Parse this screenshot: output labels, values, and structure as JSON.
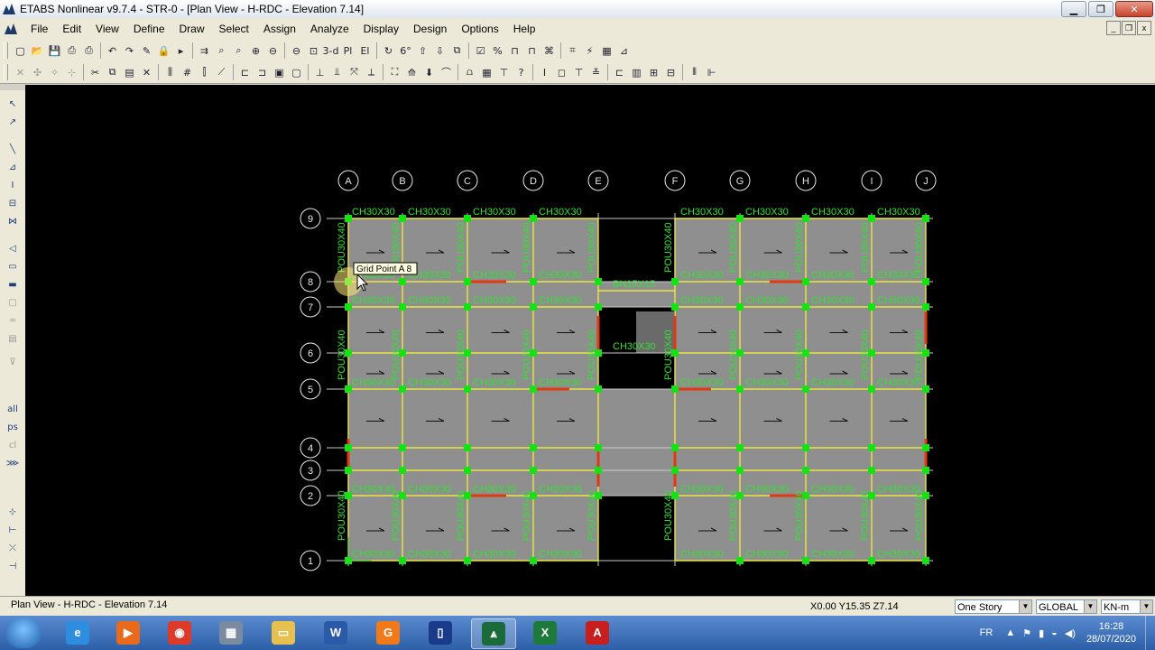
{
  "window": {
    "title": "ETABS Nonlinear v9.7.4 - STR-0 - [Plan View - H-RDC - Elevation 7.14]"
  },
  "menu": [
    "File",
    "Edit",
    "View",
    "Define",
    "Draw",
    "Select",
    "Assign",
    "Analyze",
    "Display",
    "Design",
    "Options",
    "Help"
  ],
  "toolbar1": [
    {
      "icon": "new-icon",
      "glyph": "▢"
    },
    {
      "icon": "open-icon",
      "glyph": "📂"
    },
    {
      "icon": "save-icon",
      "glyph": "💾"
    },
    {
      "icon": "print-icon",
      "glyph": "⎙"
    },
    {
      "icon": "print-preview-icon",
      "glyph": "⎙"
    },
    {
      "icon": "undo-icon",
      "glyph": "↶"
    },
    {
      "icon": "redo-icon",
      "glyph": "↷"
    },
    {
      "icon": "pencil-icon",
      "glyph": "✎"
    },
    {
      "icon": "lock-icon",
      "glyph": "🔒"
    },
    {
      "icon": "run-icon",
      "glyph": "▸"
    },
    {
      "icon": "run-steps-icon",
      "glyph": "⇉"
    },
    {
      "icon": "zoom-window-icon",
      "glyph": "⌕"
    },
    {
      "icon": "zoom-restore-icon",
      "glyph": "⌕"
    },
    {
      "icon": "zoom-in-icon",
      "glyph": "⊕"
    },
    {
      "icon": "zoom-out-icon",
      "glyph": "⊖"
    },
    {
      "icon": "zoom-all-icon",
      "glyph": "⊖"
    },
    {
      "icon": "pan-icon",
      "glyph": "⊡"
    },
    {
      "icon": "3d-view-icon",
      "glyph": "3-d"
    },
    {
      "icon": "plan-view-icon",
      "glyph": "Pl"
    },
    {
      "icon": "elevation-view-icon",
      "glyph": "El"
    },
    {
      "icon": "rotate-icon",
      "glyph": "↻"
    },
    {
      "icon": "perspective-icon",
      "glyph": "6°"
    },
    {
      "icon": "move-up-icon",
      "glyph": "⇧"
    },
    {
      "icon": "move-down-icon",
      "glyph": "⇩"
    },
    {
      "icon": "object-shrink-icon",
      "glyph": "⧉"
    },
    {
      "icon": "check-icon",
      "glyph": "☑"
    },
    {
      "icon": "assign-percent-icon",
      "glyph": "%"
    },
    {
      "icon": "frame-icon",
      "glyph": "⊓"
    },
    {
      "icon": "beam-icon",
      "glyph": "⊓"
    },
    {
      "icon": "brace-icon",
      "glyph": "⌘"
    },
    {
      "icon": "wall-icon",
      "glyph": "⌗"
    },
    {
      "icon": "lightning-icon",
      "glyph": "⚡"
    },
    {
      "icon": "grid-icon",
      "glyph": "▦"
    },
    {
      "icon": "draw-icon",
      "glyph": "⊿"
    }
  ],
  "toolbar2": [
    {
      "icon": "snap-point-icon",
      "glyph": "✕"
    },
    {
      "icon": "snap-end-icon",
      "glyph": "✣"
    },
    {
      "icon": "snap-mid-icon",
      "glyph": "✧"
    },
    {
      "icon": "snap-grid-icon",
      "glyph": "⊹"
    },
    {
      "icon": "cut-icon",
      "glyph": "✂"
    },
    {
      "icon": "copy-icon",
      "glyph": "⧉"
    },
    {
      "icon": "paste-icon",
      "glyph": "▤"
    },
    {
      "icon": "delete-icon",
      "glyph": "✕"
    },
    {
      "icon": "replicate-icon",
      "glyph": "⫼"
    },
    {
      "icon": "grid-lines-icon",
      "glyph": "#"
    },
    {
      "icon": "story-data-icon",
      "glyph": "⫿"
    },
    {
      "icon": "line-icon",
      "glyph": "⟋"
    },
    {
      "icon": "dimension-icon",
      "glyph": "⊏"
    },
    {
      "icon": "frame-section-icon",
      "glyph": "⊐"
    },
    {
      "icon": "select-all-icon",
      "glyph": "▣"
    },
    {
      "icon": "deselect-icon",
      "glyph": "▢"
    },
    {
      "icon": "join-icon",
      "glyph": "⊥"
    },
    {
      "icon": "divide-icon",
      "glyph": "⫫"
    },
    {
      "icon": "extrude-icon",
      "glyph": "⤧"
    },
    {
      "icon": "align-icon",
      "glyph": "⟂"
    },
    {
      "icon": "deformed-shape-icon",
      "glyph": "⛶"
    },
    {
      "icon": "mode-shape-icon",
      "glyph": "⟰"
    },
    {
      "icon": "loads-icon",
      "glyph": "⬇"
    },
    {
      "icon": "member-forces-icon",
      "glyph": "⌒"
    },
    {
      "icon": "stress-icon",
      "glyph": "⩍"
    },
    {
      "icon": "output-table-icon",
      "glyph": "▦"
    },
    {
      "icon": "steel-design-icon",
      "glyph": "⊤"
    },
    {
      "icon": "question-icon",
      "glyph": "?"
    },
    {
      "icon": "i-beam-icon",
      "glyph": "I"
    },
    {
      "icon": "area-section-icon",
      "glyph": "◻"
    },
    {
      "icon": "t-section-icon",
      "glyph": "⊤"
    },
    {
      "icon": "slab-icon",
      "glyph": "≚"
    },
    {
      "icon": "c-section-icon",
      "glyph": "⊏"
    },
    {
      "icon": "concrete-design-icon",
      "glyph": "▥"
    },
    {
      "icon": "shear-wall-icon",
      "glyph": "⊞"
    },
    {
      "icon": "composite-icon",
      "glyph": "⊟"
    },
    {
      "icon": "joist-icon",
      "glyph": "⫴"
    },
    {
      "icon": "wall-design-icon",
      "glyph": "⊩"
    }
  ],
  "sidebar": [
    {
      "icon": "pointer-icon",
      "glyph": "↖"
    },
    {
      "icon": "reshape-icon",
      "glyph": "↗"
    },
    {
      "icon": "draw-line-icon",
      "glyph": "╲"
    },
    {
      "icon": "draw-frame-icon",
      "glyph": "⊿"
    },
    {
      "icon": "draw-column-icon",
      "glyph": "I"
    },
    {
      "icon": "draw-beam-icon",
      "glyph": "⊟"
    },
    {
      "icon": "draw-brace-icon",
      "glyph": "⋈"
    },
    {
      "icon": "draw-area-icon",
      "glyph": "◁"
    },
    {
      "icon": "draw-rectangle-icon",
      "glyph": "▭"
    },
    {
      "icon": "draw-wall-icon",
      "glyph": "▬"
    },
    {
      "icon": "draw-opening-icon",
      "glyph": "▢"
    },
    {
      "icon": "draw-dimension-icon",
      "glyph": "═"
    },
    {
      "icon": "draw-text-icon",
      "glyph": "▤"
    },
    {
      "icon": "draw-developed-icon",
      "glyph": "⊽"
    },
    {
      "icon": "select-all-side-icon",
      "glyph": "all"
    },
    {
      "icon": "select-previous-icon",
      "glyph": "ps"
    },
    {
      "icon": "clear-selection-icon",
      "glyph": "cl"
    },
    {
      "icon": "select-intersect-icon",
      "glyph": "⋙"
    },
    {
      "icon": "snap-joint-icon",
      "glyph": "⊹"
    },
    {
      "icon": "snap-line-icon",
      "glyph": "⊢"
    },
    {
      "icon": "snap-intersect-icon",
      "glyph": "⤫"
    },
    {
      "icon": "snap-perpendicular-icon",
      "glyph": "⊣"
    }
  ],
  "plan": {
    "grid_x": [
      "A",
      "B",
      "C",
      "D",
      "E",
      "F",
      "G",
      "H",
      "I",
      "J"
    ],
    "grid_y": [
      "1",
      "2",
      "3",
      "4",
      "5",
      "6",
      "7",
      "8",
      "9"
    ],
    "beam_labels_top": [
      "CH30X30",
      "CH30X30",
      "CH30X30",
      "CH30X30",
      "CH30X30",
      "CH30X30",
      "CH30X30",
      "CH30X30"
    ],
    "beam_bridge": "BN15X15",
    "beam_mid": "CH30X30",
    "column_label": "POU30X40",
    "tooltip": "Grid Point  A  8",
    "colors": {
      "slab": "#8f8f8f",
      "grid": "#c8c8c8",
      "beam": "#e8e640",
      "text": "#34e034",
      "node": "#16e016",
      "wall": "#e03a10"
    }
  },
  "status": {
    "view": "Plan View - H-RDC - Elevation 7.14",
    "coords": "X0.00  Y15.35  Z7.14",
    "story": "One Story",
    "coord_system": "GLOBAL",
    "units": "KN-m"
  },
  "taskbar": {
    "apps": [
      {
        "name": "internet-explorer",
        "glyph": "e",
        "color": "#2d8ee0"
      },
      {
        "name": "media-player",
        "glyph": "▶",
        "color": "#e86a1a"
      },
      {
        "name": "chrome",
        "glyph": "◉",
        "color": "#dd3a2a"
      },
      {
        "name": "calculator",
        "glyph": "▦",
        "color": "#7a8aa0"
      },
      {
        "name": "file-explorer",
        "glyph": "▭",
        "color": "#e8c050"
      },
      {
        "name": "word",
        "glyph": "W",
        "color": "#2b5aa8"
      },
      {
        "name": "pdf-converter",
        "glyph": "G",
        "color": "#f07a1a"
      },
      {
        "name": "phone-link",
        "glyph": "▯",
        "color": "#1a3a8a"
      },
      {
        "name": "etabs",
        "glyph": "⩓",
        "color": "#1a6a3a"
      },
      {
        "name": "excel",
        "glyph": "X",
        "color": "#1e7a3a"
      },
      {
        "name": "autocad",
        "glyph": "A",
        "color": "#c81e1e"
      }
    ],
    "language": "FR",
    "time": "16:28",
    "date": "28/07/2020"
  }
}
